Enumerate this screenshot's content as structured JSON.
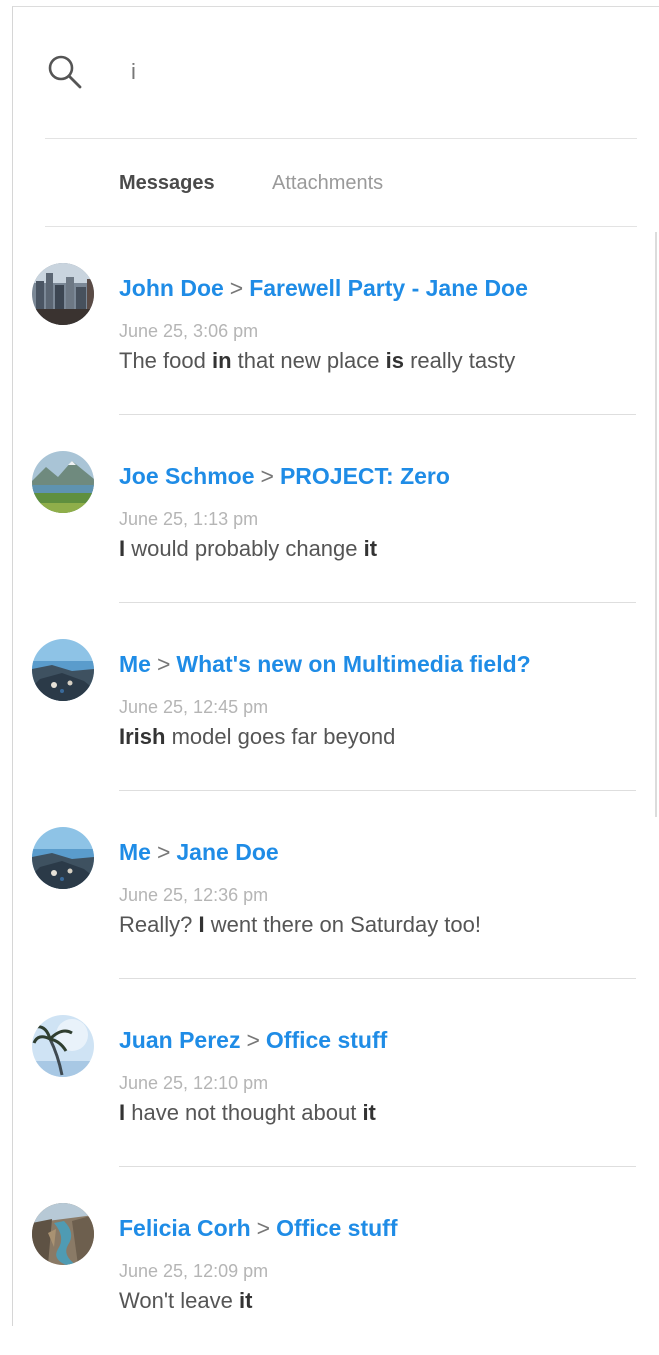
{
  "search": {
    "value": "i",
    "icon": "search-icon"
  },
  "tabs": [
    {
      "label": "Messages",
      "active": true
    },
    {
      "label": "Attachments",
      "active": false
    }
  ],
  "colors": {
    "accent": "#1f8ce6",
    "text": "#555555",
    "muted": "#b5b5b5"
  },
  "messages": [
    {
      "sender": "John Doe",
      "conversation": "Farewell Party - Jane Doe",
      "date": "June 25, 3:06 pm",
      "snippet": [
        {
          "t": "The food ",
          "b": false
        },
        {
          "t": "in",
          "b": true
        },
        {
          "t": " that new place ",
          "b": false
        },
        {
          "t": "is",
          "b": true
        },
        {
          "t": " really tasty",
          "b": false
        }
      ],
      "avatar": "city-avatar"
    },
    {
      "sender": "Joe Schmoe",
      "conversation": "PROJECT: Zero",
      "date": "June 25, 1:13 pm",
      "snippet": [
        {
          "t": "I",
          "b": true
        },
        {
          "t": " would probably change ",
          "b": false
        },
        {
          "t": "it",
          "b": true
        }
      ],
      "avatar": "mountain-lake-avatar"
    },
    {
      "sender": "Me",
      "conversation": "What's new on Multimedia field?",
      "date": "June 25, 12:45 pm",
      "snippet": [
        {
          "t": "Irish",
          "b": true
        },
        {
          "t": " model goes far beyond",
          "b": false
        }
      ],
      "avatar": "coast-avatar"
    },
    {
      "sender": "Me",
      "conversation": "Jane Doe",
      "date": "June 25, 12:36 pm",
      "snippet": [
        {
          "t": "Really? ",
          "b": false
        },
        {
          "t": "I",
          "b": true
        },
        {
          "t": " went there on Saturday too!",
          "b": false
        }
      ],
      "avatar": "coast-avatar"
    },
    {
      "sender": "Juan Perez",
      "conversation": "Office stuff",
      "date": "June 25, 12:10 pm",
      "snippet": [
        {
          "t": "I",
          "b": true
        },
        {
          "t": " have not thought about ",
          "b": false
        },
        {
          "t": "it",
          "b": true
        }
      ],
      "avatar": "palm-tree-avatar"
    },
    {
      "sender": "Felicia Corh",
      "conversation": "Office stuff",
      "date": "June 25, 12:09 pm",
      "snippet": [
        {
          "t": "Won't leave ",
          "b": false
        },
        {
          "t": "it",
          "b": true
        }
      ],
      "avatar": "canyon-river-avatar"
    }
  ]
}
